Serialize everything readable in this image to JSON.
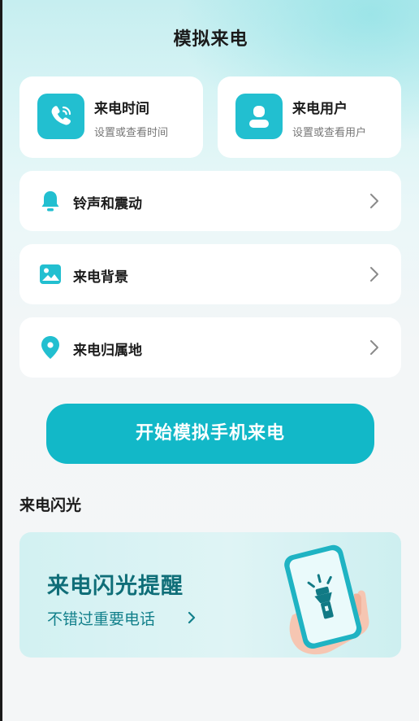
{
  "header": {
    "title": "模拟来电"
  },
  "top_cards": [
    {
      "title": "来电时间",
      "subtitle": "设置或查看时间",
      "icon": "phone-call-icon"
    },
    {
      "title": "来电用户",
      "subtitle": "设置或查看用户",
      "icon": "user-icon"
    }
  ],
  "menu": [
    {
      "label": "铃声和震动",
      "icon": "bell-icon"
    },
    {
      "label": "来电背景",
      "icon": "image-icon"
    },
    {
      "label": "来电归属地",
      "icon": "location-pin-icon"
    }
  ],
  "start_button": {
    "label": "开始模拟手机来电"
  },
  "flash_section": {
    "title": "来电闪光",
    "card_title": "来电闪光提醒",
    "card_subtitle": "不错过重要电话"
  },
  "colors": {
    "accent": "#22bfd0",
    "button": "#12b8c8",
    "flash_text": "#0f6e78"
  }
}
